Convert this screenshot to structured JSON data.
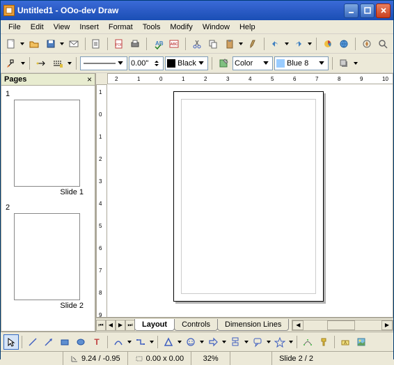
{
  "title": "Untitled1 - OOo-dev Draw",
  "menu": [
    "File",
    "Edit",
    "View",
    "Insert",
    "Format",
    "Tools",
    "Modify",
    "Window",
    "Help"
  ],
  "line_width": "0.00\"",
  "line_color": "Black",
  "fill_style": "Color",
  "fill_color": "Blue 8",
  "pages_panel": {
    "title": "Pages",
    "slides": [
      {
        "num": "1",
        "label": "Slide 1"
      },
      {
        "num": "2",
        "label": "Slide 2"
      }
    ]
  },
  "tabs": [
    "Layout",
    "Controls",
    "Dimension Lines"
  ],
  "active_tab": 0,
  "status": {
    "pos": "9.24 / -0.95",
    "size": "0.00 x 0.00",
    "zoom": "32%",
    "slide": "Slide 2 / 2"
  },
  "ruler_h": [
    "2",
    "1",
    "0",
    "1",
    "2",
    "3",
    "4",
    "5",
    "6",
    "7",
    "8",
    "9",
    "10"
  ],
  "ruler_v": [
    "1",
    "0",
    "1",
    "2",
    "3",
    "4",
    "5",
    "6",
    "7",
    "8",
    "9"
  ]
}
